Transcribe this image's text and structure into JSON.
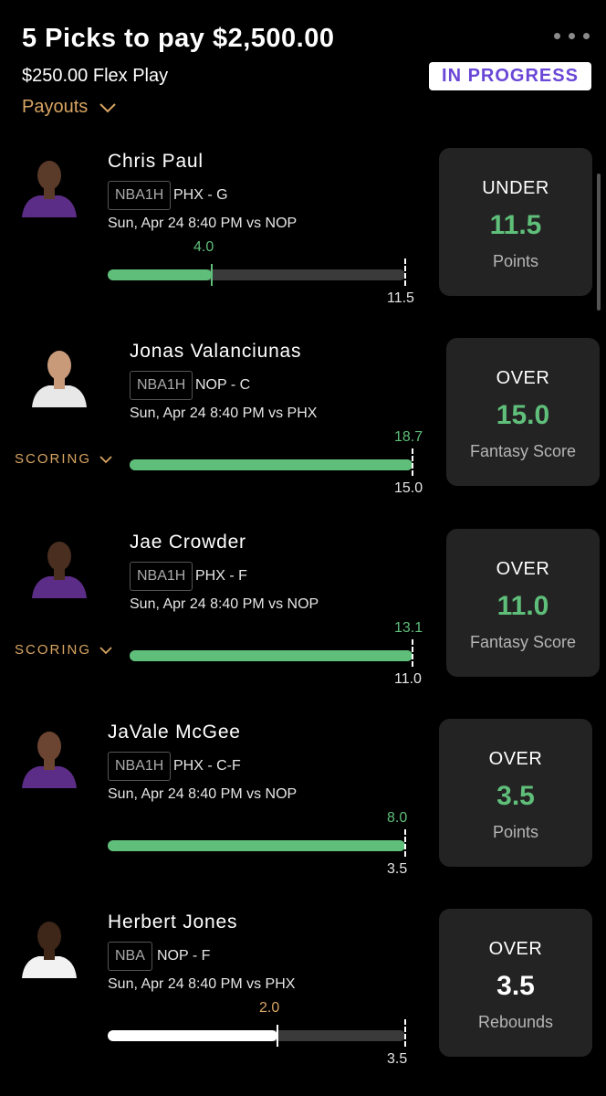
{
  "header": {
    "title": "5 Picks to pay $2,500.00",
    "subtitle": "$250.00 Flex Play",
    "status": "IN PROGRESS",
    "payouts_label": "Payouts"
  },
  "picks": [
    {
      "player": "Chris Paul",
      "league": "NBA1H",
      "team_pos": "PHX - G",
      "game": "Sun, Apr 24 8:40 PM  vs NOP",
      "current": "4.0",
      "target": "11.5",
      "progress": 0.35,
      "direction": "UNDER",
      "line": "11.5",
      "stat": "Points",
      "scoring": ""
    },
    {
      "player": "Jonas Valanciunas",
      "league": "NBA1H",
      "team_pos": "NOP - C",
      "game": "Sun, Apr 24 8:40 PM  vs PHX",
      "current": "18.7",
      "target": "15.0",
      "progress": 1.0,
      "direction": "OVER",
      "line": "15.0",
      "stat": "Fantasy Score",
      "scoring": "SCORING"
    },
    {
      "player": "Jae Crowder",
      "league": "NBA1H",
      "team_pos": "PHX - F",
      "game": "Sun, Apr 24 8:40 PM  vs NOP",
      "current": "13.1",
      "target": "11.0",
      "progress": 1.0,
      "direction": "OVER",
      "line": "11.0",
      "stat": "Fantasy Score",
      "scoring": "SCORING"
    },
    {
      "player": "JaVale McGee",
      "league": "NBA1H",
      "team_pos": "PHX - C-F",
      "game": "Sun, Apr 24 8:40 PM  vs NOP",
      "current": "8.0",
      "target": "3.5",
      "progress": 1.0,
      "direction": "OVER",
      "line": "3.5",
      "stat": "Points",
      "scoring": ""
    },
    {
      "player": "Herbert Jones",
      "league": "NBA",
      "team_pos": "NOP - F",
      "game": "Sun, Apr 24 8:40 PM  vs PHX",
      "current": "2.0",
      "target": "3.5",
      "progress": 0.57,
      "direction": "OVER",
      "line": "3.5",
      "stat": "Rebounds",
      "scoring": ""
    }
  ],
  "colors": {
    "green": "#5fbf7a",
    "orange": "#d9a563",
    "white": "#ffffff",
    "purple": "#6a47d6"
  },
  "icons": {
    "more": "more-dots-icon",
    "payouts_chevron": "chevron-down-icon",
    "scoring_chevron": "chevron-down-icon"
  }
}
